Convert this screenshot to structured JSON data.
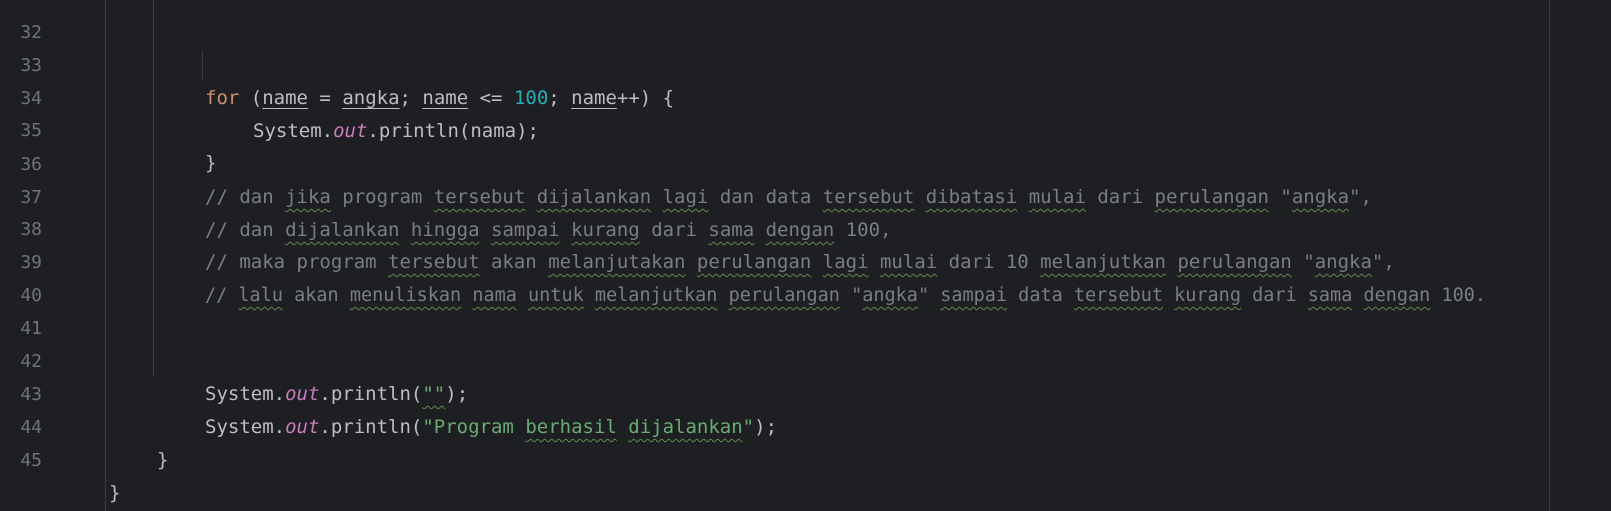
{
  "editor": {
    "colors": {
      "background": "#1e1f22",
      "line_number": "#6f737a",
      "keyword": "#cf8e6d",
      "number": "#2aacb8",
      "field": "#c77dbb",
      "comment": "#7a7e85",
      "string": "#6aab73",
      "default_text": "#bcbec4"
    },
    "top_partial_line_number": "32",
    "lines": [
      {
        "number": "33",
        "tokens": [
          "for",
          " (",
          "name",
          " = ",
          "angka",
          "; ",
          "name",
          " <= ",
          "100",
          "; ",
          "name",
          "++) {"
        ]
      },
      {
        "number": "34",
        "tokens": [
          "System.",
          "out",
          ".println(nama);"
        ]
      },
      {
        "number": "35",
        "tokens": [
          "}"
        ]
      },
      {
        "number": "36",
        "tokens": [
          "// dan ",
          "jika",
          " program ",
          "tersebut",
          " ",
          "dijalankan",
          " ",
          "lagi",
          " dan data ",
          "tersebut",
          " ",
          "dibatasi",
          " ",
          "mulai",
          " dari ",
          "perulangan",
          " \"",
          "angka",
          "\","
        ]
      },
      {
        "number": "37",
        "tokens": [
          "// dan ",
          "dijalankan",
          " ",
          "hingga",
          " ",
          "sampai",
          " ",
          "kurang",
          " dari ",
          "sama",
          " ",
          "dengan",
          " 100,"
        ]
      },
      {
        "number": "38",
        "tokens": [
          "// maka program ",
          "tersebut",
          " akan ",
          "melanjutakan",
          " ",
          "perulangan",
          " ",
          "lagi",
          " ",
          "mulai",
          " dari 10 ",
          "melanjutkan",
          " ",
          "perulangan",
          " \"",
          "angka",
          "\","
        ]
      },
      {
        "number": "39",
        "tokens": [
          "// ",
          "lalu",
          " akan ",
          "menuliskan",
          " ",
          "nama",
          " ",
          "untuk",
          " ",
          "melanjutkan",
          " ",
          "perulangan",
          " \"",
          "angka",
          "\" ",
          "sampai",
          " data ",
          "tersebut",
          " ",
          "kurang",
          " dari ",
          "sama",
          " ",
          "dengan",
          " 100."
        ]
      },
      {
        "number": "40",
        "tokens": []
      },
      {
        "number": "41",
        "tokens": []
      },
      {
        "number": "42",
        "tokens": [
          "System.",
          "out",
          ".println(",
          "\"\"",
          ");"
        ]
      },
      {
        "number": "43",
        "tokens": [
          "System.",
          "out",
          ".println(",
          "\"Program ",
          "berhasil",
          " ",
          "dijalankan",
          "\"",
          ");"
        ]
      },
      {
        "number": "44",
        "tokens": [
          "}"
        ]
      },
      {
        "number": "45",
        "tokens": [
          "}"
        ]
      }
    ]
  }
}
